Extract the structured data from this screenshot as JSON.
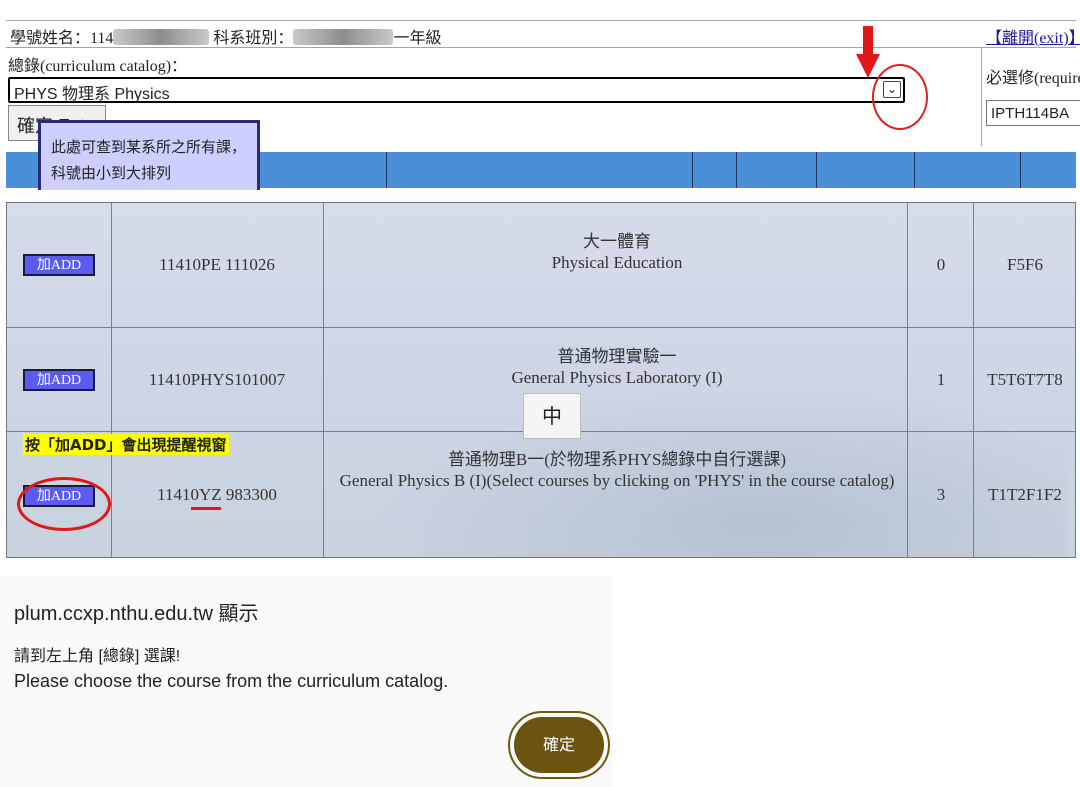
{
  "header": {
    "student_label": "學號姓名：114",
    "student_mid": "科系班別：",
    "class_suffix": "一年級",
    "exit_link": "【離開(exit)】"
  },
  "catalog": {
    "label": "總錄(curriculum catalog)：",
    "selected": "PHYS 物理系 Physics",
    "confirm_button": "確定 Ent"
  },
  "required": {
    "label": "必選修(required",
    "value": "IPTH114BA"
  },
  "tooltip": {
    "line1": "此處可查到某系所之所有課，",
    "line2": "科號由小到大排列"
  },
  "courses": [
    {
      "add_label": "加ADD",
      "code": "11410PE 111026",
      "title_zh": "大一體育",
      "title_en": "Physical Education",
      "credits": "0",
      "time": "F5F6"
    },
    {
      "add_label": "加ADD",
      "code": "11410PHYS101007",
      "title_zh": "普通物理實驗一",
      "title_en": "General Physics Laboratory (I)",
      "credits": "1",
      "time": "T5T6T7T8"
    },
    {
      "add_label": "加ADD",
      "code": "11410YZ 983300",
      "title_zh": "普通物理B一(於物理系PHYS總錄中自行選課)",
      "title_en": "General Physics B (I)(Select courses by clicking on 'PHYS' in the course catalog)",
      "credits": "3",
      "time": "T1T2F1F2"
    }
  ],
  "annotations": {
    "note": "按「加ADD」會出現提醒視窗",
    "ime_indicator": "中",
    "highlight_color": "#e01818"
  },
  "dialog": {
    "title": "plum.ccxp.nthu.edu.tw 顯示",
    "message_zh": "請到左上角 [總錄] 選課!",
    "message_en": "Please choose the course from the curriculum catalog.",
    "ok_button": "確定"
  }
}
